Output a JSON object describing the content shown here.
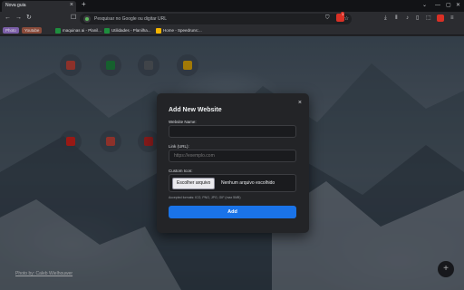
{
  "browser": {
    "tab": {
      "title": "Nova guia",
      "close_glyph": "×"
    },
    "new_tab_glyph": "+",
    "window_controls": [
      "⌄",
      "—",
      "▢",
      "✕"
    ],
    "omnibox": {
      "placeholder": "Pesquisar no Google ou digitar URL"
    },
    "extension_badge": "1",
    "bookmarks": [
      {
        "label": "Photo",
        "style": "chip",
        "color": "#7b5ea7"
      },
      {
        "label": "Youtube",
        "style": "chip",
        "color": "#8a4b3a"
      },
      {
        "label": "maquinas ai - Planil...",
        "icon_color": "#1e8e3e"
      },
      {
        "label": "Utilidades - Planilha...",
        "icon_color": "#1e8e3e"
      },
      {
        "label": "Home - Speedruns:...",
        "icon_color": "#f4b400"
      }
    ]
  },
  "page": {
    "photo_credit": "Photo by: Caleb Wielhouwer",
    "fab_glyph": "+"
  },
  "modal": {
    "title": "Add New Website",
    "close_glyph": "×",
    "name_label": "Website Name:",
    "name_value": "",
    "link_label": "Link (URL):",
    "link_placeholder": "https://exemplo.com",
    "icon_label": "Custom Icon:",
    "file_button": "Escolher arquivo",
    "file_status": "Nenhum arquivo escolhido",
    "formats_note": "Accepted formats: ICO, PNG, JPG, GIF (max 5MB)",
    "add_button": "Add"
  },
  "colors": {
    "accent": "#1a73e8",
    "modal_bg": "#232427"
  }
}
